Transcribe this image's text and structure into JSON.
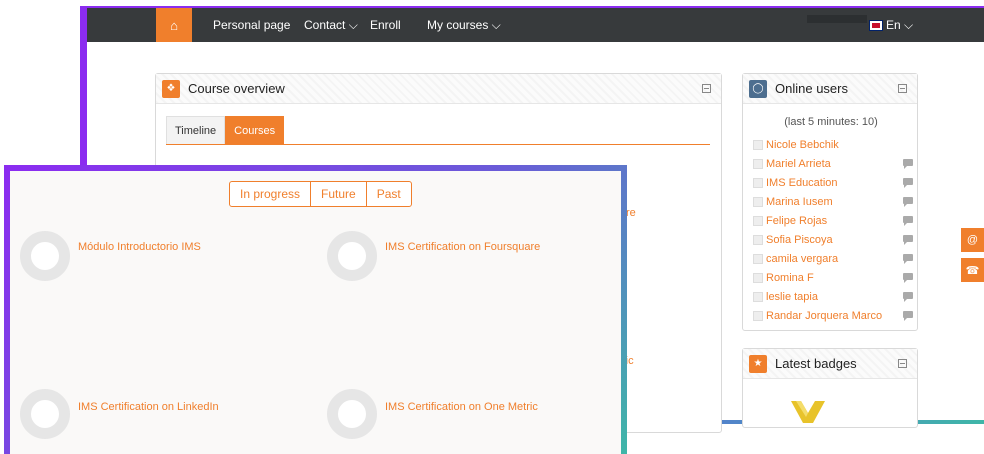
{
  "navbar": {
    "items": [
      "Personal page",
      "Contact ⌵",
      "Enroll",
      "My courses ⌵"
    ],
    "language": "En ⌵"
  },
  "course_overview": {
    "title": "Course overview",
    "tabs": [
      "Timeline",
      "Courses"
    ],
    "active_tab": "Courses",
    "bg_partial": [
      "re",
      "ric"
    ]
  },
  "online_users": {
    "title": "Online users",
    "subtitle": "(last 5 minutes: 10)",
    "users": [
      "Nicole Bebchik",
      "Mariel Arrieta",
      "IMS Education",
      "Marina Iusem",
      "Felipe Rojas",
      "Sofia Piscoya",
      "camila vergara",
      "Romina F",
      "leslie tapia",
      "Randar Jorquera Marco"
    ]
  },
  "latest_badges": {
    "title": "Latest badges"
  },
  "side_tabs": [
    "@",
    "☎"
  ],
  "overlay": {
    "filters": [
      "In progress",
      "Future",
      "Past"
    ],
    "courses": [
      {
        "name": "Módulo Introductorio IMS",
        "progress": "0%"
      },
      {
        "name": "IMS Certification on Foursquare",
        "progress": "0%"
      },
      {
        "name": "IMS Certification on LinkedIn",
        "progress": "0%"
      },
      {
        "name": "IMS Certification on One Metric",
        "progress": "0%"
      }
    ]
  },
  "colors": {
    "accent": "#f07f2c",
    "navbar": "#373a3c",
    "frame_purple": "#8b2cf0",
    "frame_teal": "#3fb6a8"
  }
}
